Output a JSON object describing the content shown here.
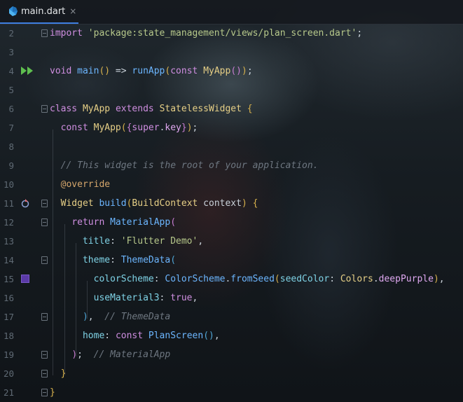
{
  "tab": {
    "filename": "main.dart",
    "close_glyph": "×",
    "icon": "dart-icon",
    "accent": "#3e7ee0"
  },
  "colors": {
    "keyword": "#cf8ee0",
    "string": "#b7c98b",
    "function": "#6cb6ff",
    "type": "#e6cf86",
    "comment": "#6e7781",
    "swatch_deep_purple": "#5b3aa8"
  },
  "lines": [
    {
      "n": "2",
      "tokens": [
        [
          "k",
          "import"
        ],
        [
          "p",
          " "
        ],
        [
          "s",
          "'package:state_management/views/plan_screen.dart'"
        ],
        [
          "p",
          ";"
        ]
      ]
    },
    {
      "n": "3",
      "tokens": []
    },
    {
      "n": "4",
      "tokens": [
        [
          "k",
          "void"
        ],
        [
          "p",
          " "
        ],
        [
          "f",
          "main"
        ],
        [
          "br1",
          "()"
        ],
        [
          "p",
          " => "
        ],
        [
          "f",
          "runApp"
        ],
        [
          "br1",
          "("
        ],
        [
          "k",
          "const"
        ],
        [
          "p",
          " "
        ],
        [
          "t",
          "MyApp"
        ],
        [
          "br2",
          "()"
        ],
        [
          "br1",
          ")"
        ],
        [
          "p",
          ";"
        ]
      ]
    },
    {
      "n": "5",
      "tokens": []
    },
    {
      "n": "6",
      "tokens": [
        [
          "k",
          "class"
        ],
        [
          "p",
          " "
        ],
        [
          "t",
          "MyApp"
        ],
        [
          "p",
          " "
        ],
        [
          "k",
          "extends"
        ],
        [
          "p",
          " "
        ],
        [
          "t",
          "StatelessWidget"
        ],
        [
          "p",
          " "
        ],
        [
          "br1",
          "{"
        ]
      ]
    },
    {
      "n": "7",
      "tokens": [
        [
          "p",
          "  "
        ],
        [
          "k",
          "const"
        ],
        [
          "p",
          " "
        ],
        [
          "t",
          "MyApp"
        ],
        [
          "br1",
          "("
        ],
        [
          "br2",
          "{"
        ],
        [
          "k",
          "super"
        ],
        [
          "p",
          "."
        ],
        [
          "n",
          "key"
        ],
        [
          "br2",
          "}"
        ],
        [
          "br1",
          ")"
        ],
        [
          "p",
          ";"
        ]
      ]
    },
    {
      "n": "8",
      "tokens": []
    },
    {
      "n": "9",
      "tokens": [
        [
          "p",
          "  "
        ],
        [
          "c",
          "// This widget is the root of your application."
        ]
      ]
    },
    {
      "n": "10",
      "tokens": [
        [
          "p",
          "  "
        ],
        [
          "a",
          "@override"
        ]
      ]
    },
    {
      "n": "11",
      "tokens": [
        [
          "p",
          "  "
        ],
        [
          "t",
          "Widget"
        ],
        [
          "p",
          " "
        ],
        [
          "f",
          "build"
        ],
        [
          "br1",
          "("
        ],
        [
          "t",
          "BuildContext"
        ],
        [
          "p",
          " context"
        ],
        [
          "br1",
          ")"
        ],
        [
          "p",
          " "
        ],
        [
          "br1",
          "{"
        ]
      ]
    },
    {
      "n": "12",
      "tokens": [
        [
          "p",
          "    "
        ],
        [
          "k",
          "return"
        ],
        [
          "p",
          " "
        ],
        [
          "f",
          "MaterialApp"
        ],
        [
          "br2",
          "("
        ]
      ]
    },
    {
      "n": "13",
      "tokens": [
        [
          "p",
          "      "
        ],
        [
          "pp",
          "title"
        ],
        [
          "p",
          ": "
        ],
        [
          "s",
          "'Flutter Demo'"
        ],
        [
          "p",
          ","
        ]
      ]
    },
    {
      "n": "14",
      "tokens": [
        [
          "p",
          "      "
        ],
        [
          "pp",
          "theme"
        ],
        [
          "p",
          ": "
        ],
        [
          "f",
          "ThemeData"
        ],
        [
          "br3",
          "("
        ]
      ]
    },
    {
      "n": "15",
      "tokens": [
        [
          "p",
          "        "
        ],
        [
          "pp",
          "colorScheme"
        ],
        [
          "p",
          ": "
        ],
        [
          "f",
          "ColorScheme"
        ],
        [
          "p",
          "."
        ],
        [
          "f",
          "fromSeed"
        ],
        [
          "br1",
          "("
        ],
        [
          "pp",
          "seedColor"
        ],
        [
          "p",
          ": "
        ],
        [
          "t",
          "Colors"
        ],
        [
          "p",
          "."
        ],
        [
          "n",
          "deepPurple"
        ],
        [
          "br1",
          ")"
        ],
        [
          "p",
          ","
        ]
      ]
    },
    {
      "n": "16",
      "tokens": [
        [
          "p",
          "        "
        ],
        [
          "pp",
          "useMaterial3"
        ],
        [
          "p",
          ": "
        ],
        [
          "k",
          "true"
        ],
        [
          "p",
          ","
        ]
      ]
    },
    {
      "n": "17",
      "tokens": [
        [
          "p",
          "      "
        ],
        [
          "br3",
          ")"
        ],
        [
          "p",
          ",  "
        ],
        [
          "c",
          "// ThemeData"
        ]
      ]
    },
    {
      "n": "18",
      "tokens": [
        [
          "p",
          "      "
        ],
        [
          "pp",
          "home"
        ],
        [
          "p",
          ": "
        ],
        [
          "k",
          "const"
        ],
        [
          "p",
          " "
        ],
        [
          "f",
          "PlanScreen"
        ],
        [
          "br3",
          "()"
        ],
        [
          "p",
          ","
        ]
      ]
    },
    {
      "n": "19",
      "tokens": [
        [
          "p",
          "    "
        ],
        [
          "br2",
          ")"
        ],
        [
          "p",
          ";  "
        ],
        [
          "c",
          "// MaterialApp"
        ]
      ]
    },
    {
      "n": "20",
      "tokens": [
        [
          "p",
          "  "
        ],
        [
          "br1",
          "}"
        ]
      ]
    },
    {
      "n": "21",
      "tokens": [
        [
          "br1",
          "}"
        ]
      ]
    }
  ],
  "gutter": {
    "run_line": "4",
    "override_line": "11",
    "swatch_line": "15",
    "fold_lines": [
      "2",
      "6",
      "11",
      "12",
      "14",
      "17",
      "19",
      "20",
      "21"
    ]
  }
}
